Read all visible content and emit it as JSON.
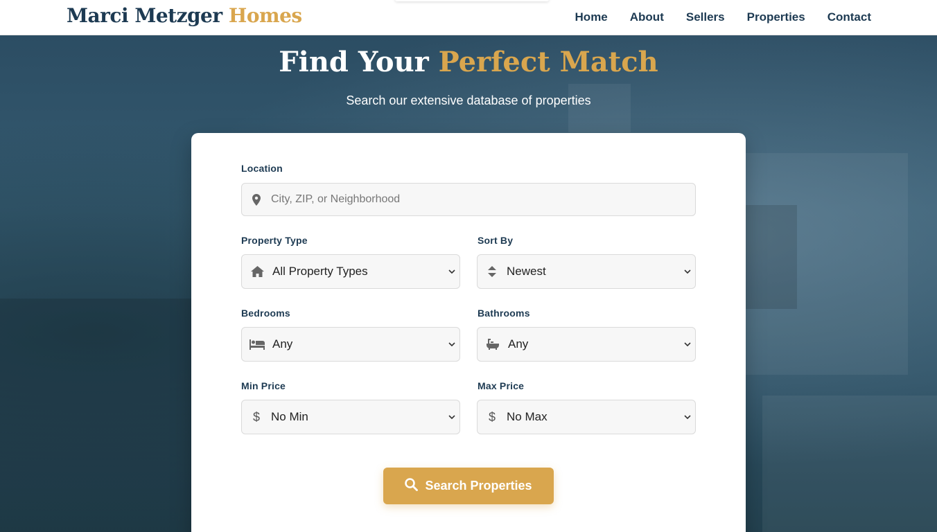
{
  "header": {
    "brand_part1": "Marci Metzger",
    "brand_part2": "Homes",
    "nav": [
      "Home",
      "About",
      "Sellers",
      "Properties",
      "Contact"
    ]
  },
  "hero": {
    "title_part1": "Find Your",
    "title_part2": "Perfect Match",
    "subtitle": "Search our extensive database of properties"
  },
  "search": {
    "location_label": "Location",
    "location_placeholder": "City, ZIP, or Neighborhood",
    "property_type_label": "Property Type",
    "property_type_value": "All Property Types",
    "sort_label": "Sort By",
    "sort_value": "Newest",
    "bedrooms_label": "Bedrooms",
    "bedrooms_value": "Any",
    "bathrooms_label": "Bathrooms",
    "bathrooms_value": "Any",
    "min_price_label": "Min Price",
    "min_price_value": "No Min",
    "max_price_label": "Max Price",
    "max_price_value": "No Max",
    "submit_label": "Search Properties"
  },
  "colors": {
    "navy": "#1d3a52",
    "gold": "#d9a64e",
    "overlay": "#2b4a60"
  },
  "icons": {
    "location": "map-marker-icon",
    "property_type": "home-icon",
    "sort": "sort-icon",
    "bedrooms": "bed-icon",
    "bathrooms": "bath-icon",
    "price": "dollar-icon",
    "search": "search-icon",
    "dropdown": "chevron-down-icon"
  }
}
